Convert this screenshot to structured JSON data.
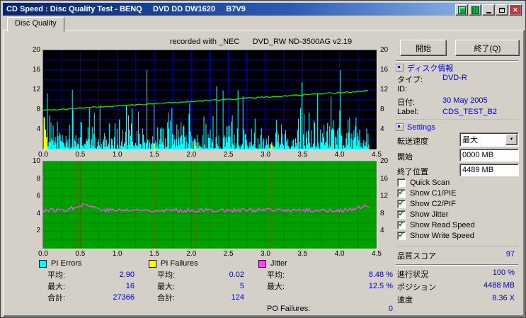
{
  "window": {
    "title": "CD Speed : Disc Quality Test - BENQ     DVD DD DW1620     B7V9"
  },
  "tab": {
    "label": "Disc Quality"
  },
  "chart_note": "recorded with _NEC      DVD_RW ND-3500AG v2.19",
  "buttons": {
    "start": "開始",
    "exit": "終了(Q)"
  },
  "icons": {
    "close": "✕",
    "dropdown": "▼",
    "check": "✓"
  },
  "colors": {
    "value_text": "#0000cc",
    "section_header": "#0000ff",
    "titlebar_left": "#0a246a",
    "titlebar_right": "#a6caf0"
  },
  "disc_info": {
    "header": "ディスク情報",
    "rows": [
      {
        "label": "タイプ:",
        "value": "DVD-R"
      },
      {
        "label": "ID:",
        "value": ""
      },
      {
        "label": "日付:",
        "value": "30 May 2005"
      },
      {
        "label": "Label:",
        "value": "CDS_TEST_B2"
      }
    ]
  },
  "settings": {
    "header": "Settings",
    "transfer_label": "転送速度",
    "transfer_value": "最大",
    "start_label": "開始",
    "start_value": "0000 MB",
    "end_label": "終了位置",
    "end_value": "4489 MB",
    "checkboxes": [
      {
        "label": "Quick Scan",
        "checked": false
      },
      {
        "label": "Show C1/PIE",
        "checked": true
      },
      {
        "label": "Show C2/PIF",
        "checked": true
      },
      {
        "label": "Show Jitter",
        "checked": true
      },
      {
        "label": "Show Read Speed",
        "checked": true
      },
      {
        "label": "Show Write Speed",
        "checked": true
      }
    ]
  },
  "status": {
    "score_label": "品質スコア",
    "score_value": "97",
    "progress_label": "進行状況",
    "progress_value": "100 %",
    "position_label": "ポジション",
    "position_value": "4488 MB",
    "speed_label": "速度",
    "speed_value": "8.36 X"
  },
  "legends": [
    {
      "title": "PI Errors",
      "color": "#00ffff",
      "rows": [
        {
          "label": "平均:",
          "value": "2.90"
        },
        {
          "label": "最大:",
          "value": "16"
        },
        {
          "label": "合計:",
          "value": "27366"
        }
      ]
    },
    {
      "title": "PI Failures",
      "color": "#ffff00",
      "rows": [
        {
          "label": "平均:",
          "value": "0.02"
        },
        {
          "label": "最大:",
          "value": "5"
        },
        {
          "label": "合計:",
          "value": "124"
        }
      ]
    },
    {
      "title": "Jitter",
      "color": "#ff44ff",
      "rows": [
        {
          "label": "平均:",
          "value": "8.48 %"
        },
        {
          "label": "最大:",
          "value": "12.5 %"
        },
        {
          "label": "PO Failures:",
          "value": "0"
        }
      ]
    }
  ],
  "chart_data": [
    {
      "type": "area",
      "name": "pi_errors_and_speed",
      "x_range": [
        0,
        4.5
      ],
      "data_x_end": 4.4,
      "x_ticks": [
        "0.0",
        "0.5",
        "1.0",
        "1.5",
        "2.0",
        "2.5",
        "3.0",
        "3.5",
        "4.0",
        "4.5"
      ],
      "y_left_ticks": [
        "20",
        "16",
        "12",
        "8",
        "4"
      ],
      "y_right_ticks": [
        "20",
        "16",
        "12",
        "8",
        "4"
      ],
      "y_left_max": 20,
      "y_right_max": 20,
      "bg": "#000000",
      "grid_color": "#0000cc",
      "grid_x_step": 0.25,
      "grid_y_step": 2,
      "series": [
        {
          "name": "PI Errors",
          "color": "#00ffff",
          "style": "spikes",
          "avg": 2.9,
          "max": 16,
          "total": 27366,
          "seed": 1234,
          "n": 470,
          "base": 2.2,
          "spike_prob": 0.02,
          "spike_max": 13
        },
        {
          "name": "PI Failures",
          "color": "#ffff00",
          "style": "bars",
          "avg": 0.02,
          "max": 5,
          "total": 124,
          "marks": [
            {
              "x": 0.015,
              "h": 6.5
            },
            {
              "x": 0.03,
              "h": 4
            },
            {
              "x": 0.045,
              "h": 2.5
            },
            {
              "x": 1.5,
              "h": 1.2
            },
            {
              "x": 2.05,
              "h": 1.5
            },
            {
              "x": 3.08,
              "h": 1.0
            }
          ]
        },
        {
          "name": "Write Speed",
          "color": "#00ee00",
          "style": "line",
          "start": 7.9,
          "end": 11.8,
          "noise": 0.25,
          "seed": 99
        }
      ]
    },
    {
      "type": "line",
      "name": "jitter",
      "x_range": [
        0,
        4.5
      ],
      "data_x_end": 4.4,
      "x_ticks": [
        "0.0",
        "0.5",
        "1.0",
        "1.5",
        "2.0",
        "2.5",
        "3.0",
        "3.5",
        "4.0",
        "4.5"
      ],
      "y_left_ticks": [
        "10",
        "8",
        "6",
        "4",
        "2"
      ],
      "y_right_ticks": [
        "20",
        "16",
        "12",
        "8",
        "4"
      ],
      "y_left_max": 10,
      "y_right_max": 20,
      "bg": "#00a000",
      "grid_color": "#008000",
      "grid_x_step": 0.25,
      "grid_y_step": 1,
      "series": [
        {
          "name": "Jitter",
          "color": "#ff44ff",
          "style": "line-noise",
          "avg_pct": 8.48,
          "max_pct": 12.5,
          "baseline": 4.4,
          "noise": 0.45,
          "bump_x": 0.55,
          "bump_h": 0.65,
          "end_bump_x": 4.33,
          "end_bump_h": 0.45,
          "seed": 77
        },
        {
          "name": "event markers",
          "color": "#557000",
          "style": "vlines",
          "positions": [
            0.45,
            0.52,
            1.5,
            2.05,
            3.08
          ]
        }
      ]
    }
  ]
}
